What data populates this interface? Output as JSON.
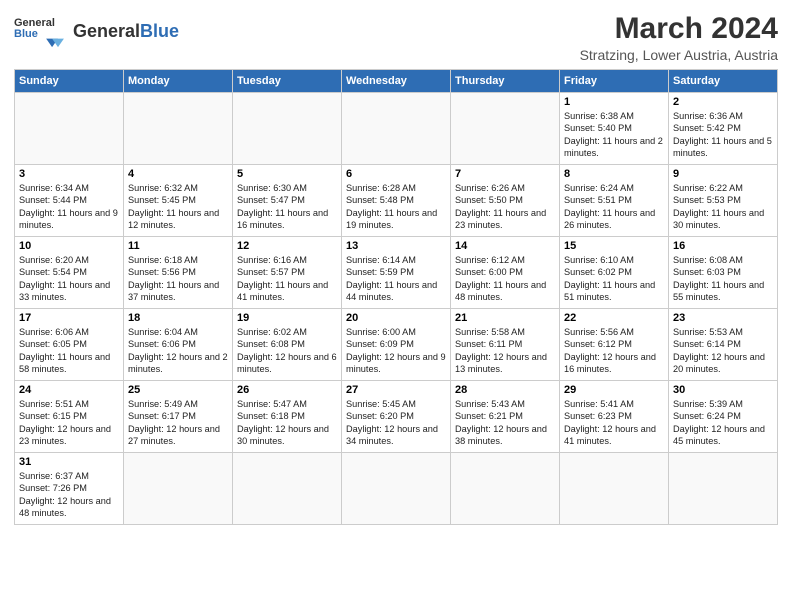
{
  "header": {
    "logo_general": "General",
    "logo_blue": "Blue",
    "title": "March 2024",
    "subtitle": "Stratzing, Lower Austria, Austria"
  },
  "weekdays": [
    "Sunday",
    "Monday",
    "Tuesday",
    "Wednesday",
    "Thursday",
    "Friday",
    "Saturday"
  ],
  "weeks": [
    [
      {
        "day": "",
        "info": ""
      },
      {
        "day": "",
        "info": ""
      },
      {
        "day": "",
        "info": ""
      },
      {
        "day": "",
        "info": ""
      },
      {
        "day": "",
        "info": ""
      },
      {
        "day": "1",
        "info": "Sunrise: 6:38 AM\nSunset: 5:40 PM\nDaylight: 11 hours\nand 2 minutes."
      },
      {
        "day": "2",
        "info": "Sunrise: 6:36 AM\nSunset: 5:42 PM\nDaylight: 11 hours\nand 5 minutes."
      }
    ],
    [
      {
        "day": "3",
        "info": "Sunrise: 6:34 AM\nSunset: 5:44 PM\nDaylight: 11 hours\nand 9 minutes."
      },
      {
        "day": "4",
        "info": "Sunrise: 6:32 AM\nSunset: 5:45 PM\nDaylight: 11 hours\nand 12 minutes."
      },
      {
        "day": "5",
        "info": "Sunrise: 6:30 AM\nSunset: 5:47 PM\nDaylight: 11 hours\nand 16 minutes."
      },
      {
        "day": "6",
        "info": "Sunrise: 6:28 AM\nSunset: 5:48 PM\nDaylight: 11 hours\nand 19 minutes."
      },
      {
        "day": "7",
        "info": "Sunrise: 6:26 AM\nSunset: 5:50 PM\nDaylight: 11 hours\nand 23 minutes."
      },
      {
        "day": "8",
        "info": "Sunrise: 6:24 AM\nSunset: 5:51 PM\nDaylight: 11 hours\nand 26 minutes."
      },
      {
        "day": "9",
        "info": "Sunrise: 6:22 AM\nSunset: 5:53 PM\nDaylight: 11 hours\nand 30 minutes."
      }
    ],
    [
      {
        "day": "10",
        "info": "Sunrise: 6:20 AM\nSunset: 5:54 PM\nDaylight: 11 hours\nand 33 minutes."
      },
      {
        "day": "11",
        "info": "Sunrise: 6:18 AM\nSunset: 5:56 PM\nDaylight: 11 hours\nand 37 minutes."
      },
      {
        "day": "12",
        "info": "Sunrise: 6:16 AM\nSunset: 5:57 PM\nDaylight: 11 hours\nand 41 minutes."
      },
      {
        "day": "13",
        "info": "Sunrise: 6:14 AM\nSunset: 5:59 PM\nDaylight: 11 hours\nand 44 minutes."
      },
      {
        "day": "14",
        "info": "Sunrise: 6:12 AM\nSunset: 6:00 PM\nDaylight: 11 hours\nand 48 minutes."
      },
      {
        "day": "15",
        "info": "Sunrise: 6:10 AM\nSunset: 6:02 PM\nDaylight: 11 hours\nand 51 minutes."
      },
      {
        "day": "16",
        "info": "Sunrise: 6:08 AM\nSunset: 6:03 PM\nDaylight: 11 hours\nand 55 minutes."
      }
    ],
    [
      {
        "day": "17",
        "info": "Sunrise: 6:06 AM\nSunset: 6:05 PM\nDaylight: 11 hours\nand 58 minutes."
      },
      {
        "day": "18",
        "info": "Sunrise: 6:04 AM\nSunset: 6:06 PM\nDaylight: 12 hours\nand 2 minutes."
      },
      {
        "day": "19",
        "info": "Sunrise: 6:02 AM\nSunset: 6:08 PM\nDaylight: 12 hours\nand 6 minutes."
      },
      {
        "day": "20",
        "info": "Sunrise: 6:00 AM\nSunset: 6:09 PM\nDaylight: 12 hours\nand 9 minutes."
      },
      {
        "day": "21",
        "info": "Sunrise: 5:58 AM\nSunset: 6:11 PM\nDaylight: 12 hours\nand 13 minutes."
      },
      {
        "day": "22",
        "info": "Sunrise: 5:56 AM\nSunset: 6:12 PM\nDaylight: 12 hours\nand 16 minutes."
      },
      {
        "day": "23",
        "info": "Sunrise: 5:53 AM\nSunset: 6:14 PM\nDaylight: 12 hours\nand 20 minutes."
      }
    ],
    [
      {
        "day": "24",
        "info": "Sunrise: 5:51 AM\nSunset: 6:15 PM\nDaylight: 12 hours\nand 23 minutes."
      },
      {
        "day": "25",
        "info": "Sunrise: 5:49 AM\nSunset: 6:17 PM\nDaylight: 12 hours\nand 27 minutes."
      },
      {
        "day": "26",
        "info": "Sunrise: 5:47 AM\nSunset: 6:18 PM\nDaylight: 12 hours\nand 30 minutes."
      },
      {
        "day": "27",
        "info": "Sunrise: 5:45 AM\nSunset: 6:20 PM\nDaylight: 12 hours\nand 34 minutes."
      },
      {
        "day": "28",
        "info": "Sunrise: 5:43 AM\nSunset: 6:21 PM\nDaylight: 12 hours\nand 38 minutes."
      },
      {
        "day": "29",
        "info": "Sunrise: 5:41 AM\nSunset: 6:23 PM\nDaylight: 12 hours\nand 41 minutes."
      },
      {
        "day": "30",
        "info": "Sunrise: 5:39 AM\nSunset: 6:24 PM\nDaylight: 12 hours\nand 45 minutes."
      }
    ],
    [
      {
        "day": "31",
        "info": "Sunrise: 6:37 AM\nSunset: 7:26 PM\nDaylight: 12 hours\nand 48 minutes."
      },
      {
        "day": "",
        "info": ""
      },
      {
        "day": "",
        "info": ""
      },
      {
        "day": "",
        "info": ""
      },
      {
        "day": "",
        "info": ""
      },
      {
        "day": "",
        "info": ""
      },
      {
        "day": "",
        "info": ""
      }
    ]
  ]
}
